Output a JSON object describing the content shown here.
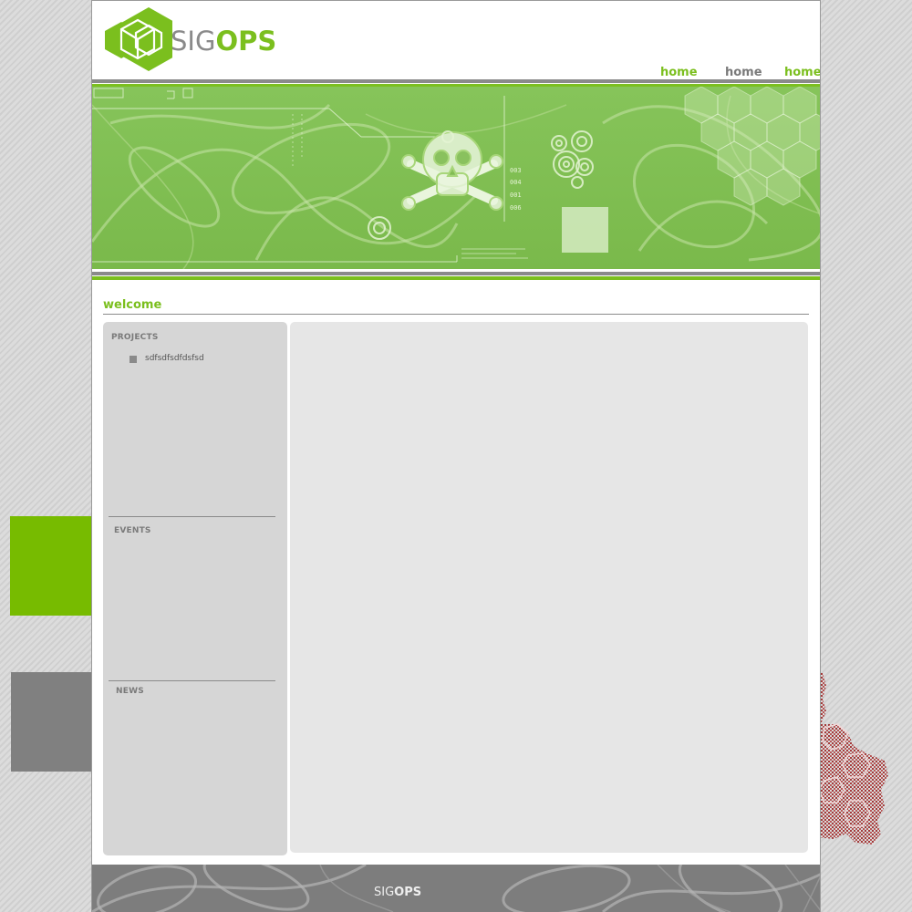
{
  "logo": {
    "sig": "SIG",
    "ops": "OPS"
  },
  "nav": {
    "items": [
      {
        "label": "home"
      },
      {
        "label": "home"
      },
      {
        "label": "home"
      }
    ]
  },
  "welcome": {
    "title": "welcome"
  },
  "sidebar": {
    "projects": {
      "title": "PROJECTS",
      "items": [
        {
          "label": "sdfsdfsdfdsfsd"
        }
      ]
    },
    "events": {
      "title": "EVENTS"
    },
    "news": {
      "title": "NEWS"
    }
  },
  "footer": {
    "sig": "SIG",
    "ops": "OPS"
  },
  "banner": {
    "codes": [
      "003",
      "004",
      "001",
      "006"
    ]
  },
  "colors": {
    "accent": "#7bbf1e",
    "gray": "#8a8a8a",
    "panel": "#d6d6d6",
    "content": "#e6e6e6"
  },
  "icons": [
    "hexagon-cube-logo-icon",
    "skull-crossbones-icon",
    "circles-icon"
  ]
}
